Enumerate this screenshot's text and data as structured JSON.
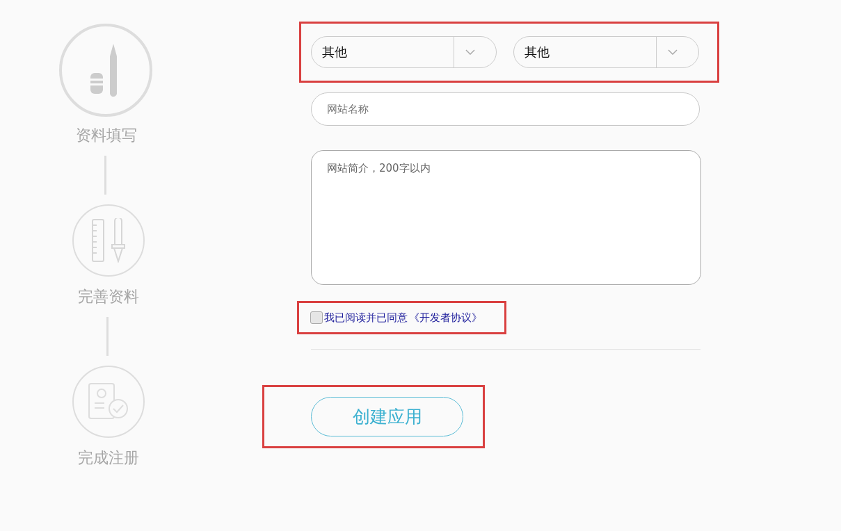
{
  "steps": [
    {
      "label": "资料填写",
      "kind": "pen",
      "selected": true
    },
    {
      "label": "完善资料",
      "kind": "ruler",
      "selected": false
    },
    {
      "label": "完成注册",
      "kind": "done",
      "selected": false
    }
  ],
  "selects": [
    {
      "value": "其他"
    },
    {
      "value": "其他"
    }
  ],
  "site_name": {
    "placeholder": "网站名称"
  },
  "site_intro": {
    "placeholder": "网站简介，200字以内"
  },
  "agreement": {
    "label": "我已阅读并已同意",
    "link": "《开发者协议》",
    "checked": false
  },
  "submit": {
    "label": "创建应用"
  }
}
